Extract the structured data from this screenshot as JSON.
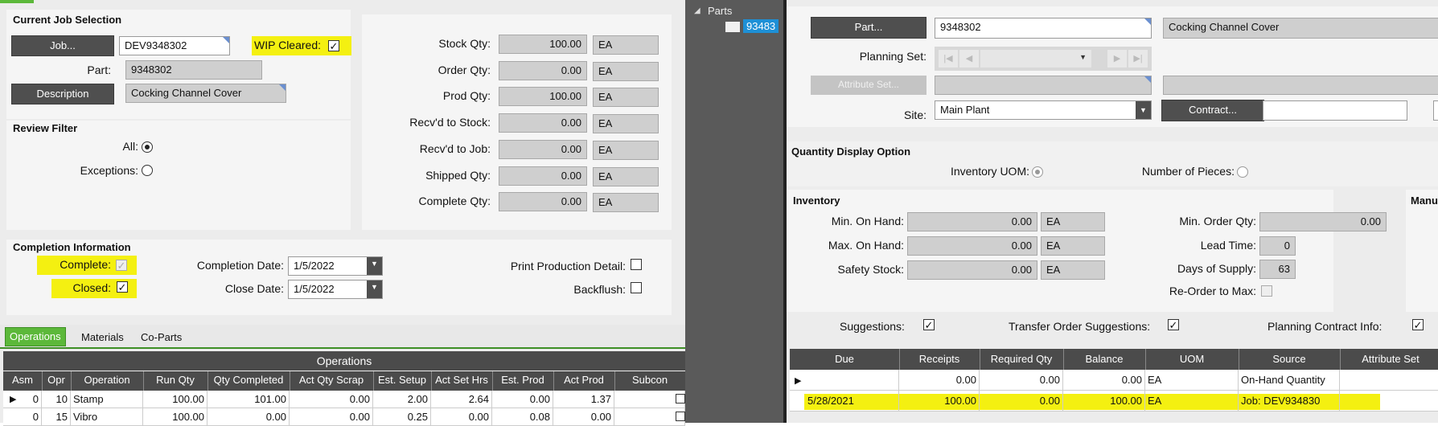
{
  "job_panel": {
    "current_job_section": "Current Job Selection",
    "job_button": "Job...",
    "job_value": "DEV9348302",
    "wip_cleared_label": "WIP Cleared:",
    "part_label": "Part:",
    "part_value": "9348302",
    "description_button": "Description",
    "description_value": "Cocking Channel Cover",
    "review_filter_section": "Review Filter",
    "all_label": "All:",
    "exceptions_label": "Exceptions:",
    "quantities": [
      {
        "label": "Stock Qty:",
        "value": "100.00",
        "uom": "EA"
      },
      {
        "label": "Order Qty:",
        "value": "0.00",
        "uom": "EA"
      },
      {
        "label": "Prod Qty:",
        "value": "100.00",
        "uom": "EA"
      },
      {
        "label": "Recv'd to Stock:",
        "value": "0.00",
        "uom": "EA"
      },
      {
        "label": "Recv'd to Job:",
        "value": "0.00",
        "uom": "EA"
      },
      {
        "label": "Shipped Qty:",
        "value": "0.00",
        "uom": "EA"
      },
      {
        "label": "Complete Qty:",
        "value": "0.00",
        "uom": "EA"
      }
    ],
    "completion_section": "Completion Information",
    "complete_label": "Complete:",
    "closed_label": "Closed:",
    "completion_date_label": "Completion Date:",
    "completion_date_value": "1/5/2022",
    "close_date_label": "Close Date:",
    "close_date_value": "1/5/2022",
    "print_production_label": "Print Production Detail:",
    "backflush_label": "Backflush:",
    "tabs": [
      "Operations",
      "Materials",
      "Co-Parts"
    ],
    "grid_title": "Operations",
    "columns": [
      "Asm",
      "Opr",
      "Operation",
      "Run Qty",
      "Qty Completed",
      "Act Qty Scrap",
      "Est. Setup",
      "Act Set Hrs",
      "Est. Prod",
      "Act Prod",
      "Subcon"
    ],
    "rows": [
      [
        "0",
        "10",
        "Stamp",
        "100.00",
        "101.00",
        "0.00",
        "2.00",
        "2.64",
        "0.00",
        "1.37",
        ""
      ],
      [
        "0",
        "15",
        "Vibro",
        "100.00",
        "0.00",
        "0.00",
        "0.25",
        "0.00",
        "0.08",
        "0.00",
        ""
      ]
    ]
  },
  "tree": {
    "root_label": "Parts",
    "child_label": "93483"
  },
  "part_panel": {
    "part_button": "Part...",
    "part_value": "9348302",
    "part_description": "Cocking Channel Cover",
    "planning_set_label": "Planning Set:",
    "attribute_set_button": "Attribute Set...",
    "site_label": "Site:",
    "site_value": "Main Plant",
    "contract_button": "Contract...",
    "qty_display_section": "Quantity Display Option",
    "inventory_uom_label": "Inventory UOM:",
    "number_of_pieces_label": "Number of Pieces:",
    "inventory_section": "Inventory",
    "manufacturing_section": "Manu",
    "inventory_left": [
      {
        "label": "Min. On Hand:",
        "value": "0.00",
        "uom": "EA"
      },
      {
        "label": "Max. On Hand:",
        "value": "0.00",
        "uom": "EA"
      },
      {
        "label": "Safety Stock:",
        "value": "0.00",
        "uom": "EA"
      }
    ],
    "min_order_qty_label": "Min. Order Qty:",
    "min_order_qty_value": "0.00",
    "lead_time_label": "Lead Time:",
    "lead_time_value": "0",
    "days_supply_label": "Days of Supply:",
    "days_supply_value": "63",
    "reorder_label": "Re-Order to Max:",
    "suggestions_label": "Suggestions:",
    "transfer_label": "Transfer Order Suggestions:",
    "planning_contract_label": "Planning Contract Info:",
    "columns": [
      "Due",
      "Receipts",
      "Required Qty",
      "Balance",
      "UOM",
      "Source",
      "Attribute Set"
    ],
    "rows": [
      [
        "",
        "0.00",
        "0.00",
        "0.00",
        "EA",
        "On-Hand Quantity",
        ""
      ],
      [
        "5/28/2021",
        "100.00",
        "0.00",
        "100.00",
        "EA",
        "Job: DEV934830",
        ""
      ]
    ]
  },
  "colors": {
    "highlight": "#f4f011",
    "accent_green": "#5cb83a",
    "dark_button": "#4f4f4f",
    "tree_selection": "#1e90d6"
  }
}
